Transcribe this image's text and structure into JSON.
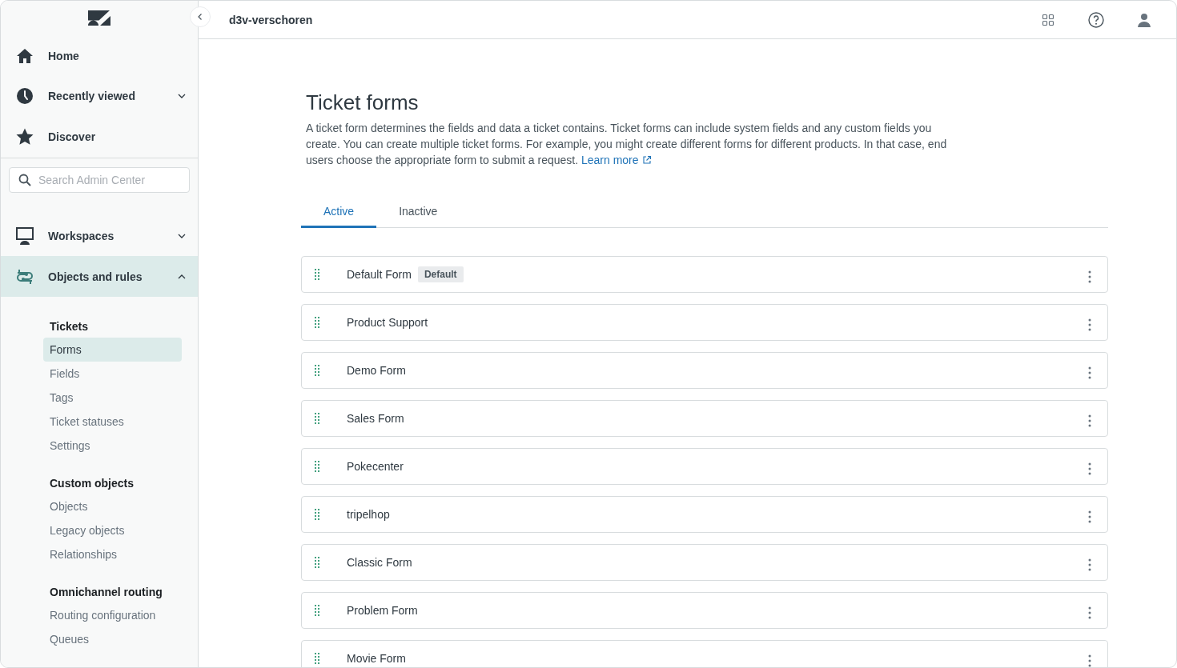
{
  "sidebar": {
    "primary": [
      {
        "label": "Home",
        "kind": "home",
        "selected": false
      },
      {
        "label": "Recently viewed",
        "kind": "clock",
        "selected": false,
        "expanded": false
      },
      {
        "label": "Discover",
        "kind": "star",
        "selected": false
      }
    ],
    "search": {
      "placeholder": "Search Admin Center"
    },
    "secondary": [
      {
        "label": "Workspaces",
        "kind": "monitor",
        "selected": false,
        "expanded": false
      },
      {
        "label": "Objects and rules",
        "kind": "objects",
        "selected": true,
        "expanded": true
      }
    ],
    "sections": [
      {
        "title": "Tickets",
        "items": [
          {
            "label": "Forms",
            "selected": true
          },
          {
            "label": "Fields",
            "selected": false
          },
          {
            "label": "Tags",
            "selected": false
          },
          {
            "label": "Ticket statuses",
            "selected": false
          },
          {
            "label": "Settings",
            "selected": false
          }
        ]
      },
      {
        "title": "Custom objects",
        "items": [
          {
            "label": "Objects",
            "selected": false
          },
          {
            "label": "Legacy objects",
            "selected": false
          },
          {
            "label": "Relationships",
            "selected": false
          }
        ]
      },
      {
        "title": "Omnichannel routing",
        "items": [
          {
            "label": "Routing configuration",
            "selected": false
          },
          {
            "label": "Queues",
            "selected": false
          }
        ]
      }
    ]
  },
  "header": {
    "account": "d3v-verschoren"
  },
  "page": {
    "title": "Ticket forms",
    "description": "A ticket form determines the fields and data a ticket contains. Ticket forms can include system fields and any custom fields you create. You can create multiple ticket forms. For example, you might create different forms for different products. In that case, end users choose the appropriate form to submit a request.",
    "link": "Learn more",
    "tabs": [
      {
        "label": "Active",
        "selected": true
      },
      {
        "label": "Inactive",
        "selected": false
      }
    ],
    "forms": [
      {
        "name": "Default Form",
        "badge": "Default"
      },
      {
        "name": "Product Support"
      },
      {
        "name": "Demo Form"
      },
      {
        "name": "Sales Form"
      },
      {
        "name": "Pokecenter"
      },
      {
        "name": "tripelhop"
      },
      {
        "name": "Classic Form"
      },
      {
        "name": "Problem Form"
      },
      {
        "name": "Movie Form"
      }
    ]
  }
}
